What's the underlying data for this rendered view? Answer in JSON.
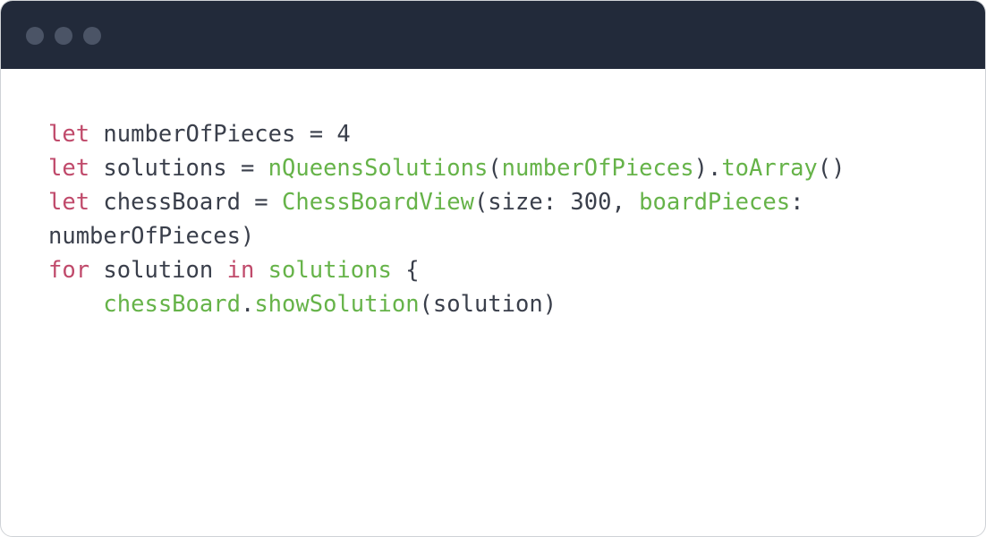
{
  "colors": {
    "titlebar": "#222a3a",
    "window_dots": "#4b5466",
    "keyword": "#c04a6b",
    "identifier": "#3a3f4b",
    "function": "#66b349",
    "background": "#ffffff"
  },
  "code_lines": [
    [
      {
        "t": "let",
        "k": "keyword"
      },
      {
        "t": " numberOfPieces = 4",
        "k": "plain"
      }
    ],
    [
      {
        "t": "let",
        "k": "keyword"
      },
      {
        "t": " solutions = ",
        "k": "plain"
      },
      {
        "t": "nQueensSolutions",
        "k": "func"
      },
      {
        "t": "(",
        "k": "plain"
      },
      {
        "t": "numberOfPieces",
        "k": "func"
      },
      {
        "t": ").",
        "k": "plain"
      },
      {
        "t": "toArray",
        "k": "func"
      },
      {
        "t": "()",
        "k": "plain"
      }
    ],
    [
      {
        "t": "let",
        "k": "keyword"
      },
      {
        "t": " chessBoard = ",
        "k": "plain"
      },
      {
        "t": "ChessBoardView",
        "k": "func"
      },
      {
        "t": "(size: 300, ",
        "k": "plain"
      },
      {
        "t": "boardPieces",
        "k": "func"
      },
      {
        "t": ":",
        "k": "plain"
      }
    ],
    [
      {
        "t": "numberOfPieces)",
        "k": "plain"
      }
    ],
    [
      {
        "t": "for",
        "k": "keyword"
      },
      {
        "t": " solution ",
        "k": "plain"
      },
      {
        "t": "in",
        "k": "keyword"
      },
      {
        "t": " ",
        "k": "plain"
      },
      {
        "t": "solutions",
        "k": "func"
      },
      {
        "t": " {",
        "k": "plain"
      }
    ],
    [
      {
        "t": "    ",
        "k": "plain"
      },
      {
        "t": "chessBoard",
        "k": "func"
      },
      {
        "t": ".",
        "k": "plain"
      },
      {
        "t": "showSolution",
        "k": "func"
      },
      {
        "t": "(solution)",
        "k": "plain"
      }
    ]
  ]
}
